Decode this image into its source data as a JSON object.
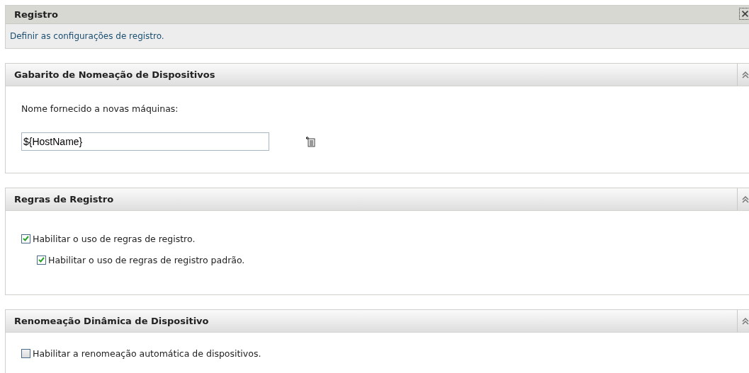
{
  "header": {
    "title": "Registro",
    "description": "Definir as configurações de registro."
  },
  "sections": [
    {
      "title": "Gabarito de Nomeação de Dispositivos",
      "expanded": true,
      "items": [
        {
          "kind": "label",
          "text": "Nome fornecido a novas máquinas:"
        },
        {
          "kind": "input",
          "value": "${HostName}"
        }
      ]
    },
    {
      "title": "Regras de Registro",
      "expanded": true,
      "items": [
        {
          "kind": "checkbox",
          "label": "Habilitar o uso de regras de registro.",
          "checked": true,
          "children": [
            {
              "kind": "checkbox",
              "label": "Habilitar o uso de regras de registro padrão.",
              "checked": true
            }
          ]
        }
      ]
    },
    {
      "title": "Renomeação Dinâmica de Dispositivo",
      "expanded": true,
      "items": [
        {
          "kind": "checkbox",
          "label": "Habilitar a renomeação automática de dispositivos.",
          "checked": false
        }
      ]
    }
  ]
}
